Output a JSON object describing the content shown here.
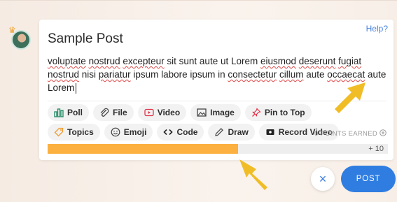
{
  "help_link": "Help?",
  "post": {
    "title": "Sample Post",
    "body_segments": [
      {
        "text": "voluptate",
        "misspelled": true
      },
      {
        "text": " ",
        "misspelled": false
      },
      {
        "text": "nostrud",
        "misspelled": true
      },
      {
        "text": " ",
        "misspelled": false
      },
      {
        "text": "excepteur",
        "misspelled": true
      },
      {
        "text": " sit sunt aute ut Lorem ",
        "misspelled": false
      },
      {
        "text": "eiusmod",
        "misspelled": true
      },
      {
        "text": " ",
        "misspelled": false
      },
      {
        "text": "deserunt",
        "misspelled": true
      },
      {
        "text": " ",
        "misspelled": false
      },
      {
        "text": "fugiat",
        "misspelled": true
      },
      {
        "text": " ",
        "misspelled": false
      },
      {
        "text": "nostrud",
        "misspelled": true
      },
      {
        "text": " nisi ",
        "misspelled": false
      },
      {
        "text": "pariatur",
        "misspelled": true
      },
      {
        "text": " ipsum labore ipsum in ",
        "misspelled": false
      },
      {
        "text": "consectetur",
        "misspelled": true
      },
      {
        "text": " ",
        "misspelled": false
      },
      {
        "text": "cillum",
        "misspelled": true
      },
      {
        "text": " aute ",
        "misspelled": false
      },
      {
        "text": "occaecat",
        "misspelled": true
      },
      {
        "text": " aute Lorem",
        "misspelled": false
      }
    ]
  },
  "toolbar": {
    "row1": [
      {
        "label": "Poll",
        "icon": "poll-icon"
      },
      {
        "label": "File",
        "icon": "paperclip-icon"
      },
      {
        "label": "Video",
        "icon": "video-icon"
      },
      {
        "label": "Image",
        "icon": "image-icon"
      },
      {
        "label": "Pin to Top",
        "icon": "pin-icon"
      }
    ],
    "row2": [
      {
        "label": "Topics",
        "icon": "tag-icon"
      },
      {
        "label": "Emoji",
        "icon": "emoji-icon"
      },
      {
        "label": "Code",
        "icon": "code-icon"
      },
      {
        "label": "Draw",
        "icon": "pencil-icon"
      },
      {
        "label": "Record Video",
        "icon": "record-video-icon"
      }
    ]
  },
  "points": {
    "label": "0 POINTS EARNED",
    "icon": "plus-circle-icon",
    "bonus": "+ 10",
    "progress": 0.56
  },
  "actions": {
    "close_icon": "×",
    "post_label": "POST"
  },
  "colors": {
    "accent": "#2f7de1",
    "progress": "#fbb040",
    "arrow": "#f0bd27",
    "misspelled": "#e04848"
  }
}
